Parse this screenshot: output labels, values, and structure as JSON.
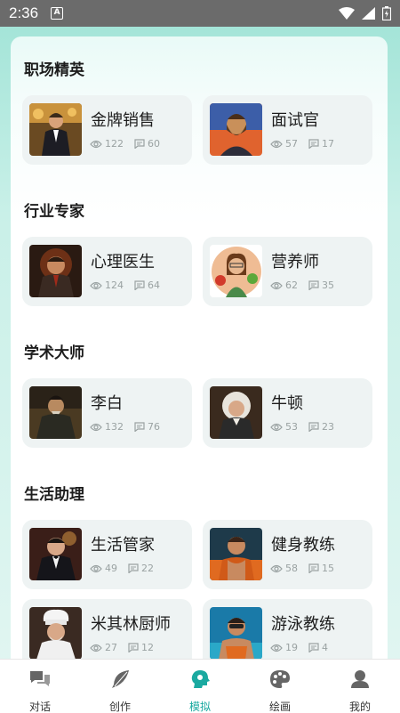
{
  "status": {
    "time": "2:36",
    "app_indicator": "A"
  },
  "sections": [
    {
      "title": "职场精英",
      "cards": [
        {
          "name": "金牌销售",
          "views": "122",
          "comments": "60"
        },
        {
          "name": "面试官",
          "views": "57",
          "comments": "17"
        }
      ]
    },
    {
      "title": "行业专家",
      "cards": [
        {
          "name": "心理医生",
          "views": "124",
          "comments": "64"
        },
        {
          "name": "营养师",
          "views": "62",
          "comments": "35"
        }
      ]
    },
    {
      "title": "学术大师",
      "cards": [
        {
          "name": "李白",
          "views": "132",
          "comments": "76"
        },
        {
          "name": "牛顿",
          "views": "53",
          "comments": "23"
        }
      ]
    },
    {
      "title": "生活助理",
      "cards": [
        {
          "name": "生活管家",
          "views": "49",
          "comments": "22"
        },
        {
          "name": "健身教练",
          "views": "58",
          "comments": "15"
        },
        {
          "name": "米其林厨师",
          "views": "27",
          "comments": "12"
        },
        {
          "name": "游泳教练",
          "views": "19",
          "comments": "4"
        }
      ]
    }
  ],
  "tabs": [
    {
      "label": "对话",
      "icon": "chat-icon"
    },
    {
      "label": "创作",
      "icon": "feather-icon"
    },
    {
      "label": "模拟",
      "icon": "head-icon",
      "active": true
    },
    {
      "label": "绘画",
      "icon": "palette-icon"
    },
    {
      "label": "我的",
      "icon": "user-icon"
    }
  ],
  "colors": {
    "accent": "#1aa9a0",
    "card_bg": "#eef3f3",
    "statusbar": "#6b6b6b"
  }
}
